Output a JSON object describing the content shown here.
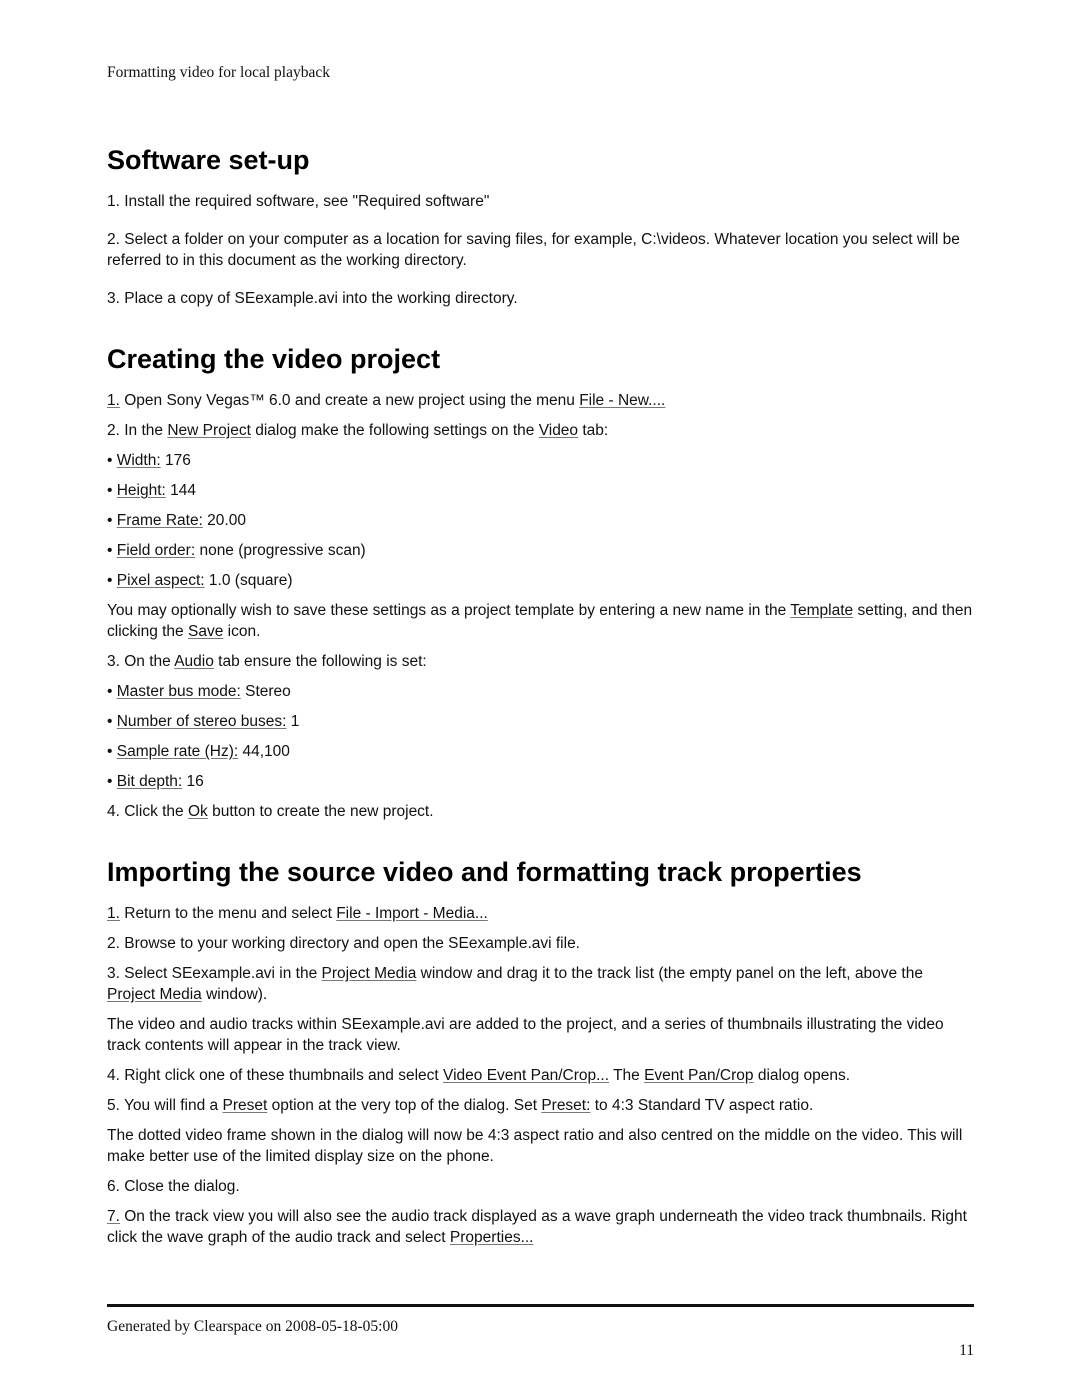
{
  "header": {
    "running_title": "Formatting video for local playback"
  },
  "sections": {
    "setup": {
      "title": "Software set-up",
      "p1": "1. Install the required software, see \"Required software\"",
      "p2": "2. Select a folder on your computer as a location for saving files, for example, C:\\videos. Whatever location you select will be referred to in this document as the working directory.",
      "p3": "3. Place a copy of SEexample.avi into the working directory."
    },
    "create": {
      "title": "Creating the video project",
      "s1_num": "1.",
      "s1_text": " Open Sony Vegas™ 6.0 and create a new project using the menu ",
      "s1_link": "File - New....",
      "s2_a": "2. In the ",
      "s2_link1": "New Project",
      "s2_b": " dialog make the following settings on the ",
      "s2_link2": "Video",
      "s2_c": " tab:",
      "video_settings": [
        {
          "label": "Width:",
          "value": " 176"
        },
        {
          "label": "Height:",
          "value": " 144"
        },
        {
          "label": "Frame Rate:",
          "value": " 20.00"
        },
        {
          "label": "Field order:",
          "value": " none (progressive scan)"
        },
        {
          "label": "Pixel aspect:",
          "value": " 1.0 (square)"
        }
      ],
      "template_a": "You may optionally wish to save these settings as a project template by entering a new name in the ",
      "template_link": "Template",
      "template_b": " setting, and then clicking the ",
      "save_link": "Save",
      "template_c": " icon.",
      "s3_a": "3. On the ",
      "s3_link": "Audio",
      "s3_b": " tab ensure the following is set:",
      "audio_settings": [
        {
          "label": "Master bus mode:",
          "value": " Stereo"
        },
        {
          "label": "Number of stereo buses:",
          "value": " 1"
        },
        {
          "label": "Sample rate (Hz):",
          "value": " 44,100"
        },
        {
          "label": "Bit depth:",
          "value": " 16"
        }
      ],
      "s4_a": "4. Click the ",
      "s4_link": "Ok",
      "s4_b": " button to create the new project."
    },
    "import": {
      "title": "Importing the source video and formatting track properties",
      "s1_num": "1.",
      "s1_text": " Return to the menu and select ",
      "s1_link": "File - Import - Media...",
      "s2": "2. Browse to your working directory and open the SEexample.avi file.",
      "s3_a": "3. Select SEexample.avi in the ",
      "s3_link1": "Project Media",
      "s3_b": " window and drag it to the track list (the empty panel on the left, above the ",
      "s3_link2": "Project Media",
      "s3_c": " window).",
      "note1": "The video and audio tracks within SEexample.avi are added to the project, and a series of thumbnails illustrating the video track contents will appear in the track view.",
      "s4_a": "4. Right click one of these thumbnails and select ",
      "s4_link1": "Video Event Pan/Crop...",
      "s4_b": " The ",
      "s4_link2": "Event Pan/Crop",
      "s4_c": " dialog opens.",
      "s5_a": "5. You will find a ",
      "s5_link1": "Preset",
      "s5_b": " option at the very top of the dialog. Set ",
      "s5_link2": "Preset:",
      "s5_c": " to 4:3 Standard TV aspect ratio.",
      "note2": "The dotted video frame shown in the dialog will now be 4:3 aspect ratio and also centred on the middle on the video. This will make better use of the limited display size on the phone.",
      "s6": "6. Close the dialog.",
      "s7_num": "7.",
      "s7_text": " On the track view you will also see the audio track displayed as a wave graph underneath the video track thumbnails. Right click the wave graph of the audio track and select ",
      "s7_link": "Properties..."
    }
  },
  "footer": {
    "generated": "Generated by Clearspace on 2008-05-18-05:00",
    "page_number": "11"
  }
}
